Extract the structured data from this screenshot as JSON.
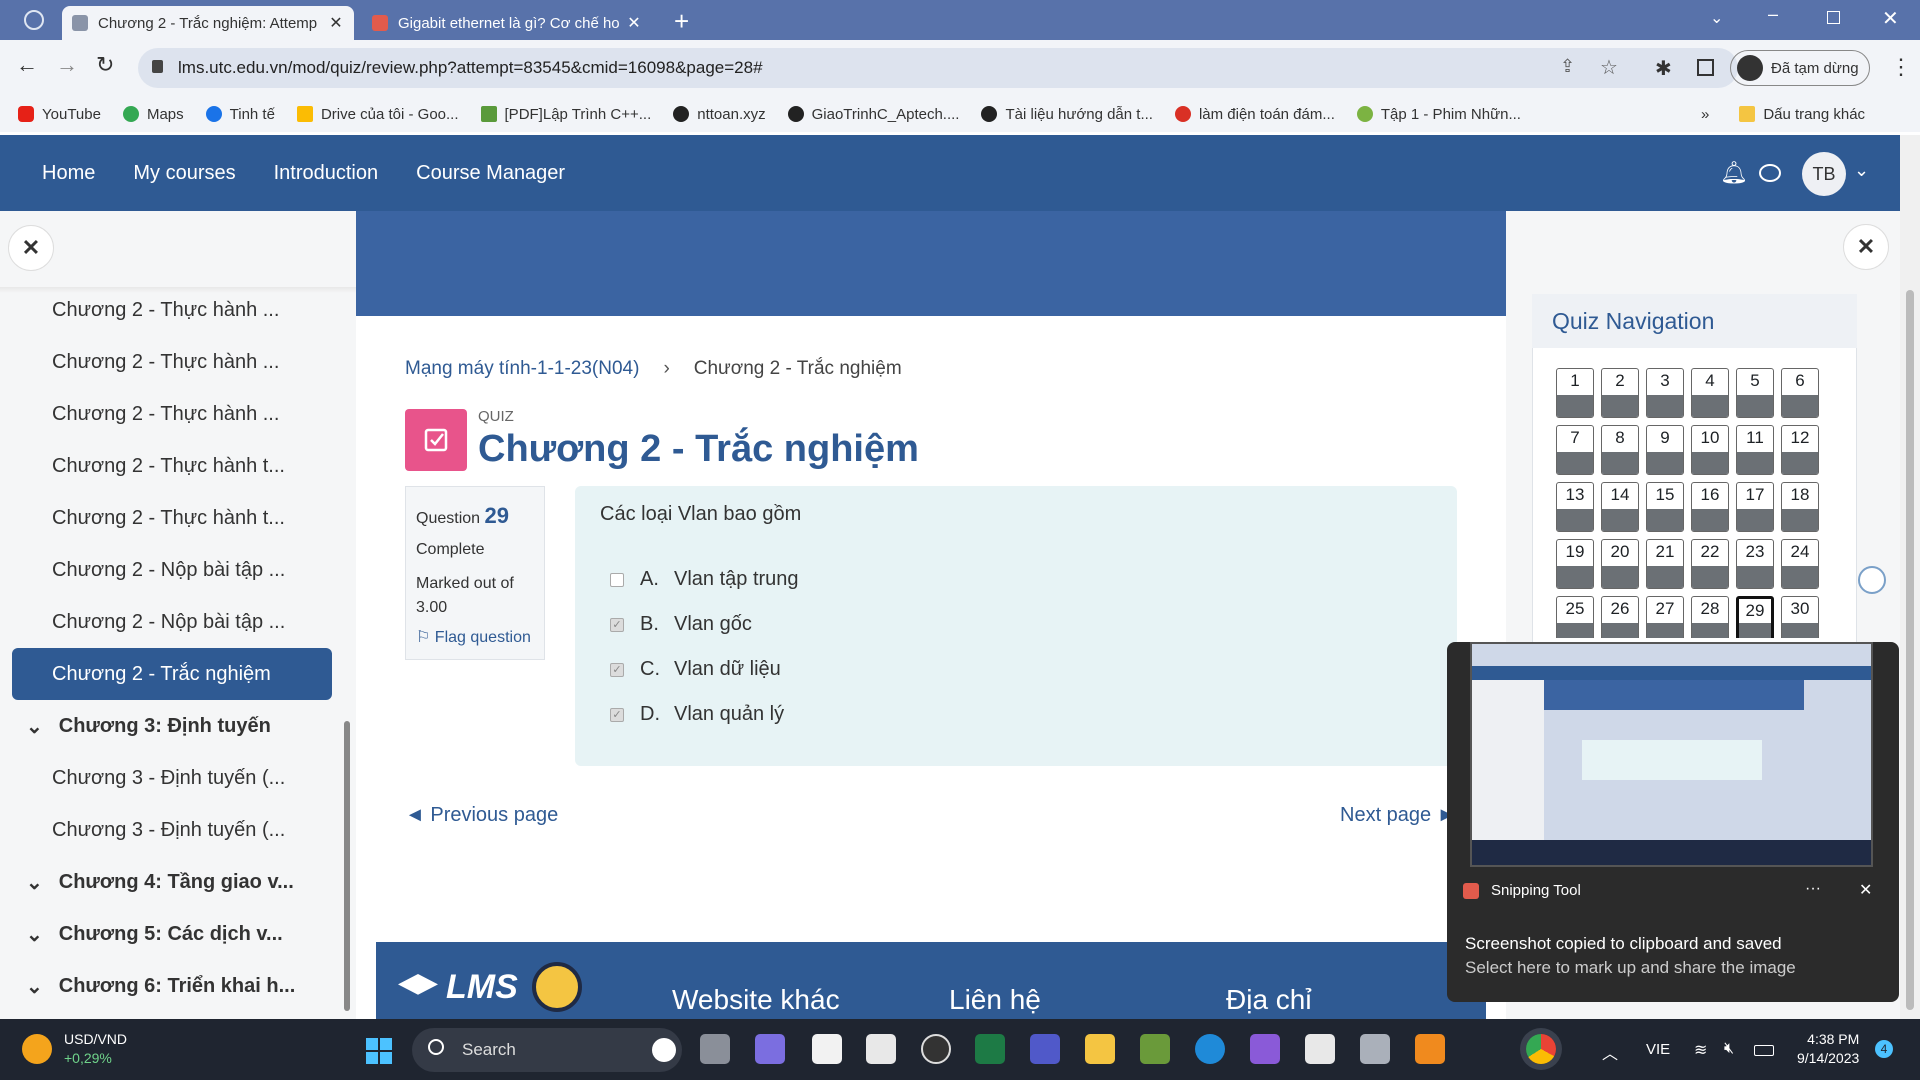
{
  "browser": {
    "tabs": [
      {
        "label": "Chương 2 - Trắc nghiệm: Attemp",
        "active": true
      },
      {
        "label": "Gigabit ethernet là gì? Cơ chế ho",
        "active": false
      }
    ],
    "url": "lms.utc.edu.vn/mod/quiz/review.php?attempt=83545&cmid=16098&page=28#",
    "profile_label": "Đã tạm dừng",
    "bookmarks": [
      "YouTube",
      "Maps",
      "Tinh tế",
      "Drive của tôi - Goo...",
      "[PDF]Lập Trình C++...",
      "nttoan.xyz",
      "GiaoTrinhC_Aptech....",
      "Tài liệu hướng dẫn t...",
      "làm điện toán đám...",
      "Tập 1 - Phim Nhữn..."
    ],
    "bookmarks_more": "»",
    "other_bookmarks": "Dấu trang khác"
  },
  "navbar": {
    "links": [
      "Home",
      "My courses",
      "Introduction",
      "Course Manager"
    ],
    "avatar_initials": "TB"
  },
  "drawer": {
    "items": [
      "Chương 2 - Thực hành ...",
      "Chương 2 - Thực hành ...",
      "Chương 2 - Thực hành ...",
      "Chương 2 - Thực hành t...",
      "Chương 2 - Thực hành t...",
      "Chương 2 - Nộp bài tập ...",
      "Chương 2 - Nộp bài tập ..."
    ],
    "active_item": "Chương 2 - Trắc nghiệm",
    "section3": "Chương 3: Định tuyến",
    "section3_items": [
      "Chương 3 - Định tuyến (...",
      "Chương 3 - Định tuyến (..."
    ],
    "sections": [
      "Chương 4: Tầng giao v...",
      "Chương 5: Các dịch v...",
      "Chương 6: Triển khai h..."
    ]
  },
  "main": {
    "breadcrumb": [
      "Mạng máy tính-1-1-23(N04)",
      "Chương 2 - Trắc nghiệm"
    ],
    "quiz_label": "QUIZ",
    "title": "Chương 2 - Trắc nghiệm",
    "question_label": "Question",
    "question_number": "29",
    "status": "Complete",
    "marked": "Marked out of 3.00",
    "flag": "Flag question",
    "question_text": "Các loại Vlan bao gồm",
    "options": [
      {
        "letter": "A.",
        "text": "Vlan tập trung",
        "checked": false
      },
      {
        "letter": "B.",
        "text": "Vlan gốc",
        "checked": true
      },
      {
        "letter": "C.",
        "text": "Vlan dữ liệu",
        "checked": true
      },
      {
        "letter": "D.",
        "text": "Vlan quản lý",
        "checked": true
      }
    ],
    "prev": "◄ Previous page",
    "next": "Next page ►"
  },
  "footer": {
    "logo": "LMS",
    "cols": [
      "Website khác",
      "Liên hệ",
      "Địa chỉ"
    ]
  },
  "quiz_nav": {
    "title": "Quiz Navigation",
    "buttons": [
      "1",
      "2",
      "3",
      "4",
      "5",
      "6",
      "7",
      "8",
      "9",
      "10",
      "11",
      "12",
      "13",
      "14",
      "15",
      "16",
      "17",
      "18",
      "19",
      "20",
      "21",
      "22",
      "23",
      "24",
      "25",
      "26",
      "27",
      "28",
      "29",
      "30"
    ],
    "current": "29"
  },
  "snip": {
    "app": "Snipping Tool",
    "more": "···",
    "title": "Screenshot copied to clipboard and saved",
    "subtitle": "Select here to mark up and share the image"
  },
  "taskbar": {
    "currency": "USD/VND",
    "change": "+0,29%",
    "search": "Search",
    "lang": "VIE",
    "time": "4:38 PM",
    "date": "9/14/2023",
    "badge": "4"
  }
}
